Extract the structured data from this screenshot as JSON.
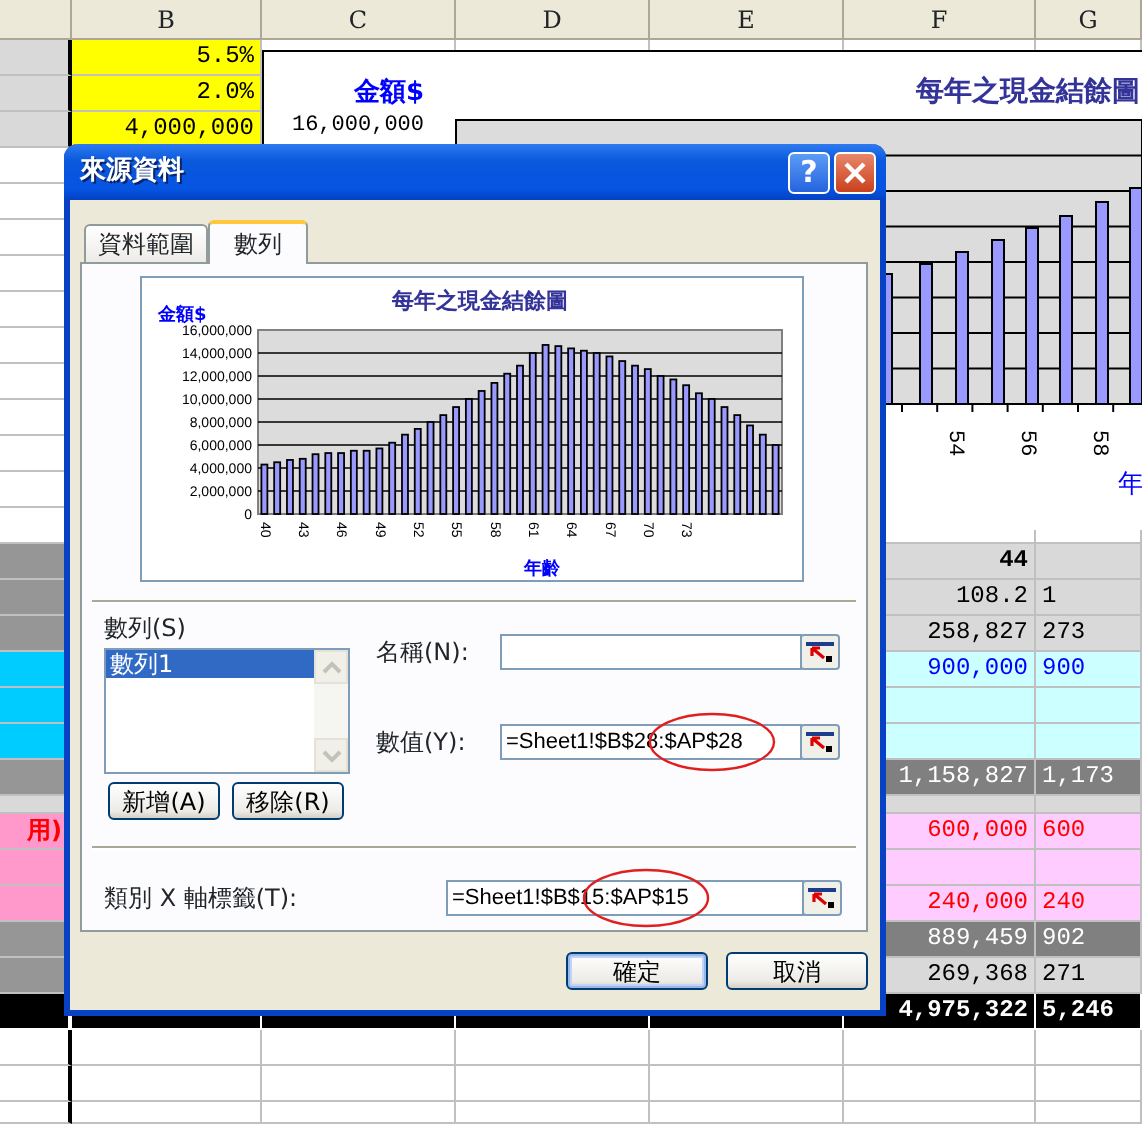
{
  "sheet": {
    "columns": [
      "B",
      "C",
      "D",
      "E",
      "F",
      "G"
    ],
    "rows": [
      {
        "kind": "input",
        "b": "5.5%"
      },
      {
        "kind": "input",
        "b": "2.0%"
      },
      {
        "kind": "input",
        "b": "4,000,000"
      },
      {
        "kind": "plain"
      },
      {
        "kind": "plain"
      },
      {
        "kind": "plain"
      },
      {
        "kind": "plain"
      },
      {
        "kind": "plain"
      },
      {
        "kind": "plain"
      },
      {
        "kind": "plain"
      },
      {
        "kind": "plain"
      },
      {
        "kind": "plain"
      },
      {
        "kind": "plain"
      },
      {
        "kind": "plain"
      },
      {
        "kind": "age",
        "f": "44"
      },
      {
        "kind": "light",
        "f": "108.2",
        "g": "1"
      },
      {
        "kind": "light",
        "f": "258,827",
        "g": "273"
      },
      {
        "kind": "income",
        "f": "900,000",
        "g": "900"
      },
      {
        "kind": "income"
      },
      {
        "kind": "income"
      },
      {
        "kind": "subtotal",
        "f": "1,158,827",
        "g": "1,173"
      },
      {
        "kind": "spacer"
      },
      {
        "kind": "expense",
        "column_a": "用)",
        "f": "600,000",
        "g": "600"
      },
      {
        "kind": "expense"
      },
      {
        "kind": "expense",
        "f": "240,000",
        "g": "240"
      },
      {
        "kind": "subtotal",
        "f": "889,459",
        "g": "902"
      },
      {
        "kind": "light",
        "f": "269,368",
        "g": "271"
      },
      {
        "kind": "total",
        "f": "4,975,322",
        "g": "5,246"
      },
      {
        "kind": "plain"
      },
      {
        "kind": "plain"
      },
      {
        "kind": "plain"
      }
    ]
  },
  "background_chart": {
    "ylabel": "金額$",
    "top_tick": "16,000,000",
    "title": "每年之現金結餘圖",
    "x_labels": [
      "54",
      "56",
      "58"
    ],
    "xlabel": "年"
  },
  "dialog": {
    "title": "來源資料",
    "help_button": "?",
    "tabs": [
      {
        "label": "資料範圍",
        "selected": false
      },
      {
        "label": "數列",
        "selected": true
      }
    ],
    "preview_chart": {
      "chart_data": {
        "type": "bar",
        "title": "每年之現金結餘圖",
        "xlabel": "年齡",
        "ylabel": "金額$",
        "x": [
          40,
          41,
          42,
          43,
          44,
          45,
          46,
          47,
          48,
          49,
          50,
          51,
          52,
          53,
          54,
          55,
          56,
          57,
          58,
          59,
          60,
          61,
          62,
          63,
          64,
          65,
          66,
          67,
          68,
          69,
          70,
          71,
          72,
          73,
          74,
          75,
          76,
          77,
          78,
          79,
          80
        ],
        "grid": true,
        "series": [
          {
            "color": "#9999ff",
            "values": [
              4300000,
              4500000,
              4700000,
              4800000,
              5200000,
              5300000,
              5300000,
              5500000,
              5500000,
              5700000,
              6200000,
              6900000,
              7400000,
              8000000,
              8600000,
              9300000,
              10000000,
              10700000,
              11400000,
              12200000,
              12900000,
              14000000,
              14700000,
              14600000,
              14400000,
              14200000,
              14000000,
              13700000,
              13300000,
              12900000,
              12600000,
              12000000,
              11700000,
              11200000,
              10500000,
              10000000,
              9300000,
              8600000,
              7700000,
              6900000,
              6000000
            ]
          }
        ],
        "xlim": [
          39.5,
          80.5
        ],
        "ylim": [
          0,
          16000000
        ],
        "xticks": [
          40,
          43,
          46,
          49,
          52,
          55,
          58,
          61,
          64,
          67,
          70,
          73
        ],
        "yticks": [
          {
            "value": 0,
            "label": "0"
          },
          {
            "value": 2000000,
            "label": "2,000,000"
          },
          {
            "value": 4000000,
            "label": "4,000,000"
          },
          {
            "value": 6000000,
            "label": "6,000,000"
          },
          {
            "value": 8000000,
            "label": "8,000,000"
          },
          {
            "value": 10000000,
            "label": "10,000,000"
          },
          {
            "value": 12000000,
            "label": "12,000,000"
          },
          {
            "value": 14000000,
            "label": "14,000,000"
          },
          {
            "value": 16000000,
            "label": "16,000,000"
          }
        ]
      }
    },
    "series_label": "數列(S)",
    "series_list": [
      {
        "label": "數列1",
        "selected": true
      }
    ],
    "add_button": "新增(A)",
    "remove_button": "移除(R)",
    "fields": [
      {
        "label": "名稱(N):",
        "circled": false
      },
      {
        "label": "數值(Y):",
        "value": "=Sheet1!$B$28:$AP$28",
        "circled": true
      }
    ],
    "category_field": {
      "label": "類別 X 軸標籤(T):",
      "value": "=Sheet1!$B$15:$AP$15",
      "circled": true
    },
    "buttons": [
      {
        "label": "確定",
        "default": true
      },
      {
        "label": "取消",
        "default": false
      }
    ]
  }
}
